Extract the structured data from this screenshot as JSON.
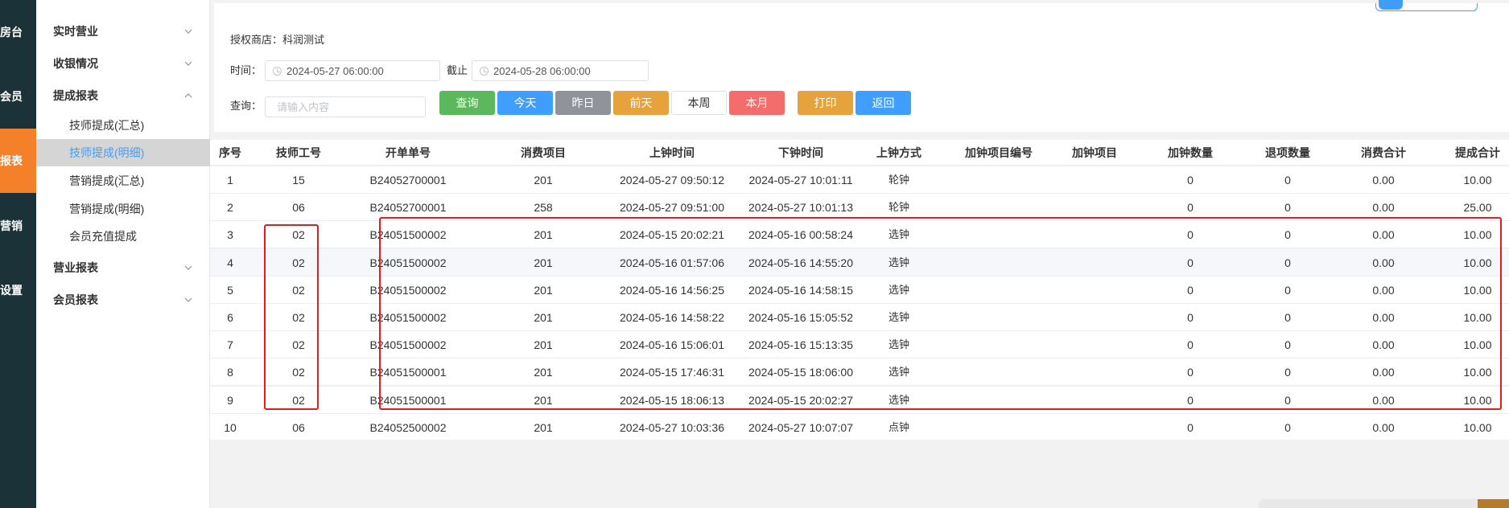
{
  "rail": [
    {
      "label": "房台",
      "active": false
    },
    {
      "label": "会员",
      "active": false
    },
    {
      "label": "报表",
      "active": true
    },
    {
      "label": "营销",
      "active": false
    },
    {
      "label": "设置",
      "active": false
    }
  ],
  "menu": {
    "realtime": "实时营业",
    "cashier": "收银情况",
    "commission": "提成报表",
    "commission_items": [
      "技师提成(汇总)",
      "技师提成(明细)",
      "营销提成(汇总)",
      "营销提成(明细)",
      "会员充值提成"
    ],
    "business": "营业报表",
    "member": "会员报表"
  },
  "filter": {
    "store_label": "授权商店：科润测试",
    "time_label": "时间：",
    "start_time": "2024-05-27 06:00:00",
    "until_label": "截止",
    "end_time": "2024-05-28 06:00:00",
    "query_label": "查询：",
    "search_placeholder": "请输入内容"
  },
  "buttons": [
    {
      "label": "查询",
      "color": "#5cb85c"
    },
    {
      "label": "今天",
      "color": "#409eff"
    },
    {
      "label": "昨日",
      "color": "#909399"
    },
    {
      "label": "前天",
      "color": "#e6a23c"
    },
    {
      "label": "本周",
      "color": "#ffffff"
    },
    {
      "label": "本月",
      "color": "#f56c6c"
    },
    {
      "label": "打印",
      "color": "#e6a23c"
    },
    {
      "label": "返回",
      "color": "#409eff"
    }
  ],
  "table": {
    "headers": [
      "序号",
      "技师工号",
      "开单单号",
      "消费项目",
      "上钟时间",
      "下钟时间",
      "上钟方式",
      "加钟项目编号",
      "加钟项目",
      "加钟数量",
      "退项数量",
      "消费合计",
      "提成合计"
    ],
    "rows": [
      [
        "1",
        "15",
        "B24052700001",
        "201",
        "2024-05-27 09:50:12",
        "2024-05-27 10:01:11",
        "轮钟",
        "",
        "",
        "0",
        "0",
        "0.00",
        "10.00"
      ],
      [
        "2",
        "06",
        "B24052700001",
        "258",
        "2024-05-27 09:51:00",
        "2024-05-27 10:01:13",
        "轮钟",
        "",
        "",
        "0",
        "0",
        "0.00",
        "25.00"
      ],
      [
        "3",
        "02",
        "B24051500002",
        "201",
        "2024-05-15 20:02:21",
        "2024-05-16 00:58:24",
        "选钟",
        "",
        "",
        "0",
        "0",
        "0.00",
        "10.00"
      ],
      [
        "4",
        "02",
        "B24051500002",
        "201",
        "2024-05-16 01:57:06",
        "2024-05-16 14:55:20",
        "选钟",
        "",
        "",
        "0",
        "0",
        "0.00",
        "10.00"
      ],
      [
        "5",
        "02",
        "B24051500002",
        "201",
        "2024-05-16 14:56:25",
        "2024-05-16 14:58:15",
        "选钟",
        "",
        "",
        "0",
        "0",
        "0.00",
        "10.00"
      ],
      [
        "6",
        "02",
        "B24051500002",
        "201",
        "2024-05-16 14:58:22",
        "2024-05-16 15:05:52",
        "选钟",
        "",
        "",
        "0",
        "0",
        "0.00",
        "10.00"
      ],
      [
        "7",
        "02",
        "B24051500002",
        "201",
        "2024-05-16 15:06:01",
        "2024-05-16 15:13:35",
        "选钟",
        "",
        "",
        "0",
        "0",
        "0.00",
        "10.00"
      ],
      [
        "8",
        "02",
        "B24051500001",
        "201",
        "2024-05-15 17:46:31",
        "2024-05-15 18:06:00",
        "选钟",
        "",
        "",
        "0",
        "0",
        "0.00",
        "10.00"
      ],
      [
        "9",
        "02",
        "B24051500001",
        "201",
        "2024-05-15 18:06:13",
        "2024-05-15 20:02:27",
        "选钟",
        "",
        "",
        "0",
        "0",
        "0.00",
        "10.00"
      ],
      [
        "10",
        "06",
        "B24052500002",
        "201",
        "2024-05-27 10:03:36",
        "2024-05-27 10:07:07",
        "点钟",
        "",
        "",
        "0",
        "0",
        "0.00",
        "10.00"
      ]
    ]
  }
}
